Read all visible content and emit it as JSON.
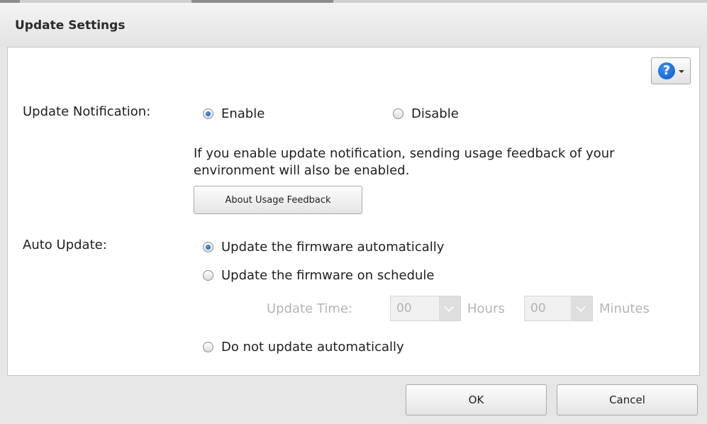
{
  "dialog": {
    "title": "Update Settings"
  },
  "help": {
    "icon": "help-icon",
    "glyph": "?"
  },
  "update_notification": {
    "label": "Update Notification:",
    "options": [
      {
        "label": "Enable",
        "checked": true
      },
      {
        "label": "Disable",
        "checked": false
      }
    ],
    "description_line1": "If you enable update notification, sending usage feedback of your",
    "description_line2": "environment will also be enabled.",
    "about_button": "About Usage Feedback"
  },
  "auto_update": {
    "label": "Auto Update:",
    "options": [
      {
        "label": "Update the firmware automatically",
        "checked": true
      },
      {
        "label": "Update the firmware on schedule",
        "checked": false
      },
      {
        "label": "Do not update automatically",
        "checked": false
      }
    ],
    "update_time": {
      "label": "Update Time:",
      "hours_value": "00",
      "hours_unit": "Hours",
      "minutes_value": "00",
      "minutes_unit": "Minutes",
      "disabled": true
    }
  },
  "footer": {
    "ok_label": "OK",
    "cancel_label": "Cancel"
  }
}
